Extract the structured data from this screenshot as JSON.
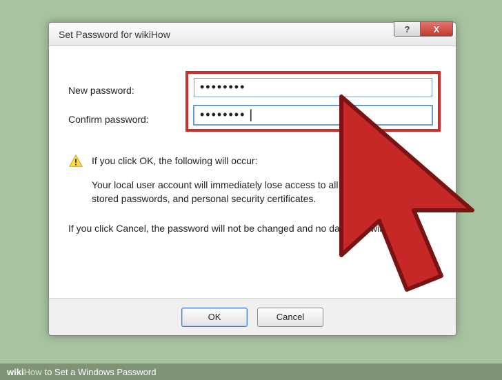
{
  "dialog": {
    "title": "Set Password for wikiHow",
    "help_symbol": "?",
    "close_symbol": "X",
    "labels": {
      "new_password": "New password:",
      "confirm_password": "Confirm password:"
    },
    "fields": {
      "new_password_value": "••••••••",
      "confirm_password_value": "••••••••"
    },
    "warning_heading": "If you click OK, the following will occur:",
    "warning_body": "Your local user account will immediately lose access to all of its encrypted files, stored passwords, and personal security certificates.",
    "cancel_info": "If you click Cancel, the password will not be changed and no data loss will occur.",
    "buttons": {
      "ok": "OK",
      "cancel": "Cancel"
    }
  },
  "footer": {
    "brand_prefix": "wiki",
    "brand_suffix": "How",
    "article": " to Set a Windows Password"
  }
}
